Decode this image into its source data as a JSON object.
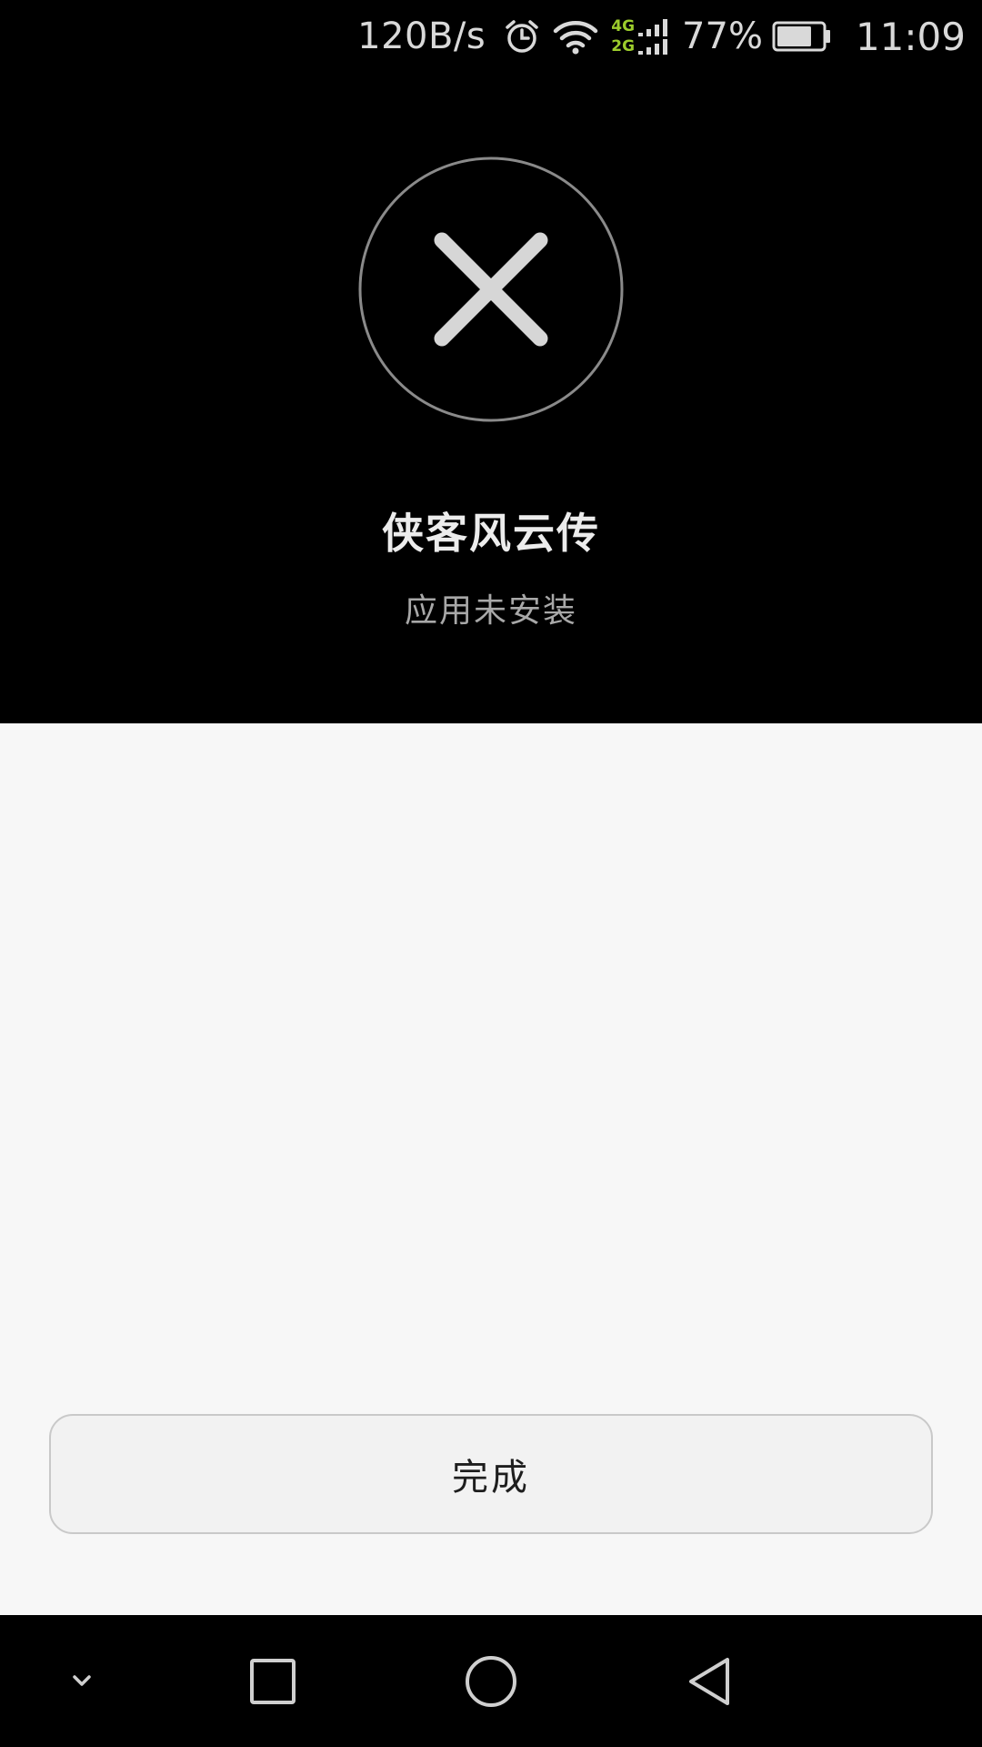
{
  "status_bar": {
    "net_speed": "120B/s",
    "network_top": "4G",
    "network_bottom": "2G",
    "battery_percent": "77%",
    "time": "11:09",
    "icons": [
      "alarm-icon",
      "wifi-icon",
      "signal-icon",
      "battery-icon"
    ],
    "network_color": "#9ccc2c",
    "battery_level": 0.77
  },
  "header": {
    "status_icon": "close-circle-icon",
    "app_name": "侠客风云传",
    "status_text": "应用未安装"
  },
  "actions": {
    "done_label": "完成"
  },
  "nav_bar": {
    "icons": [
      "chevron-down-icon",
      "recents-square-icon",
      "home-circle-icon",
      "back-triangle-icon"
    ]
  }
}
